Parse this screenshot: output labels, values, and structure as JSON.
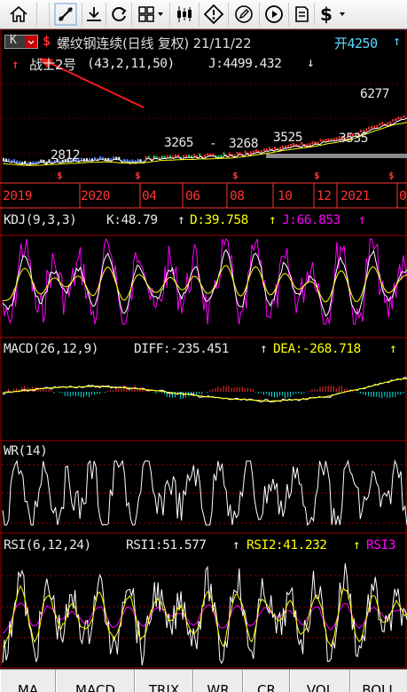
{
  "toolbar": {
    "items": [
      {
        "name": "home-icon"
      },
      {
        "name": "draw-line-icon"
      },
      {
        "name": "download-icon"
      },
      {
        "name": "refresh-icon"
      },
      {
        "name": "grid-icon"
      },
      {
        "name": "candlestick-icon"
      },
      {
        "name": "alert-icon"
      },
      {
        "name": "edit-icon"
      },
      {
        "name": "play-icon"
      },
      {
        "name": "notes-icon"
      },
      {
        "name": "dollar-icon",
        "label": "$"
      }
    ]
  },
  "header": {
    "k_label": "K",
    "dollar": "$",
    "title": "螺纹钢连续(日线 复权) 21/11/22",
    "open_label": "开4250",
    "up_arrow": "↑",
    "indicator_name": "战士2号",
    "indicator_params": "(43,2,11,50)",
    "indicator_value": "J:4499.432",
    "down_arrow": "↓"
  },
  "price_chart": {
    "labels": [
      "2812",
      "3265",
      "3268",
      "3525",
      "3535",
      "6277"
    ],
    "signal_marker": "$",
    "time_axis": [
      "2019",
      "2020",
      "04",
      "06",
      "08",
      "10",
      "12",
      "2021",
      "0"
    ]
  },
  "kdj": {
    "name": "KDJ(9,3,3)",
    "k": "K:48.79",
    "d": "D:39.758",
    "j": "J:66.853",
    "arrow": "↑"
  },
  "macd": {
    "name": "MACD(26,12,9)",
    "diff": "DIFF:-235.451",
    "dea": "DEA:-268.718",
    "arrow": "↑"
  },
  "wr": {
    "name": "WR(14)"
  },
  "rsi": {
    "name": "RSI(6,12,24)",
    "rsi1": "RSI1:51.577",
    "rsi2": "RSI2:41.232",
    "rsi3": "RSI3",
    "arrow": "↑"
  },
  "tabs": [
    "MA",
    "MACD",
    "TRIX",
    "WR",
    "CR",
    "VOL",
    "BOLL"
  ],
  "colors": {
    "k": "#ffffff",
    "d": "#ffff00",
    "j": "#ff00ff",
    "up": "#ff3030",
    "down": "#00ffff",
    "grid": "#a00000",
    "axis": "#ff3333"
  }
}
